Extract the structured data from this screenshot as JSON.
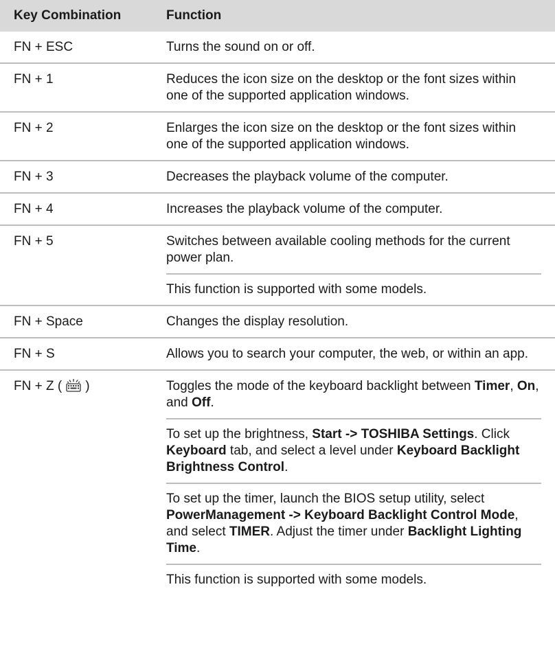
{
  "table": {
    "headers": {
      "key": "Key Combination",
      "function": "Function"
    },
    "rows": [
      {
        "key": "FN + ESC",
        "desc": "Turns the sound on or off."
      },
      {
        "key": "FN + 1",
        "desc": "Reduces the icon size on the desktop or the font sizes within one of the supported application windows."
      },
      {
        "key": "FN + 2",
        "desc": "Enlarges the icon size on the desktop or the font sizes within one of the supported application windows."
      },
      {
        "key": "FN + 3",
        "desc": "Decreases the playback volume of the computer."
      },
      {
        "key": "FN + 4",
        "desc": "Increases the playback volume of the computer."
      },
      {
        "key": "FN + 5",
        "desc": "Switches between available cooling methods for the current power plan.",
        "note": "This function is supported with some models."
      },
      {
        "key": "FN + Space",
        "desc": "Changes the display resolution."
      },
      {
        "key": "FN + S",
        "desc": "Allows you to search your computer, the web, or within an app."
      }
    ],
    "backlight_row": {
      "key_prefix": "FN + Z (",
      "key_suffix": ")",
      "icon": "keyboard-backlight-icon",
      "p1": {
        "a": "Toggles the mode of the keyboard backlight between ",
        "b1": "Timer",
        "c": ", ",
        "b2": "On",
        "d": ", and ",
        "b3": "Off",
        "e": "."
      },
      "p2": {
        "a": "To set up the brightness, ",
        "b1": "Start -> TOSHIBA Settings",
        "c": ". Click ",
        "b2": "Keyboard",
        "d": " tab, and select a level under ",
        "b3": "Keyboard Backlight Brightness Control",
        "e": "."
      },
      "p3": {
        "a": "To set up the timer, launch the BIOS setup utility, select ",
        "b1": "PowerManagement -> Keyboard Backlight Control Mode",
        "c": ", and select ",
        "b2": "TIMER",
        "d": ". Adjust the timer under ",
        "b3": "Backlight Lighting Time",
        "e": "."
      },
      "note": "This function is supported with some models."
    }
  }
}
